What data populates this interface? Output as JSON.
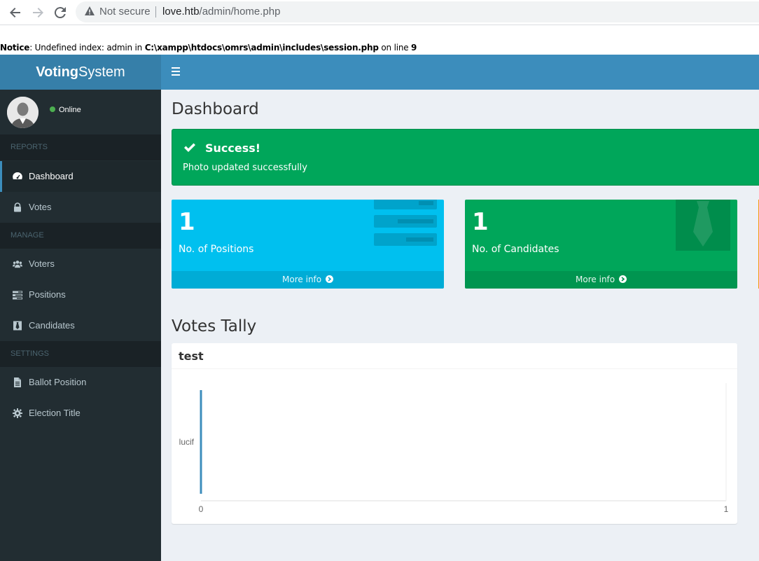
{
  "browser": {
    "security_label": "Not secure",
    "url_host": "love.htb",
    "url_path": "/admin/home.php"
  },
  "notice": {
    "label": "Notice",
    "text_before": ": Undefined index: admin in ",
    "path": "C:\\xampp\\htdocs\\omrs\\admin\\includes\\session.php",
    "text_after": " on line ",
    "line": "9"
  },
  "header": {
    "logo_bold": "Voting",
    "logo_rest": "System"
  },
  "sidebar": {
    "user_status": "Online",
    "sections": [
      {
        "header": "REPORTS",
        "items": [
          {
            "label": "Dashboard",
            "icon": "dashboard-icon",
            "active": true
          },
          {
            "label": "Votes",
            "icon": "lock-icon",
            "active": false
          }
        ]
      },
      {
        "header": "MANAGE",
        "items": [
          {
            "label": "Voters",
            "icon": "users-icon",
            "active": false
          },
          {
            "label": "Positions",
            "icon": "tasks-icon",
            "active": false
          },
          {
            "label": "Candidates",
            "icon": "tie-icon",
            "active": false
          }
        ]
      },
      {
        "header": "SETTINGS",
        "items": [
          {
            "label": "Ballot Position",
            "icon": "file-icon",
            "active": false
          },
          {
            "label": "Election Title",
            "icon": "cog-icon",
            "active": false
          }
        ]
      }
    ]
  },
  "main": {
    "page_title": "Dashboard",
    "alert": {
      "title": "Success!",
      "message": "Photo updated successfully",
      "color": "#00a65a"
    },
    "stat_boxes": [
      {
        "value": "1",
        "label": "No. of Positions",
        "footer": "More info",
        "color": "#00c0ef",
        "icon": "tasks-icon"
      },
      {
        "value": "1",
        "label": "No. of Candidates",
        "footer": "More info",
        "color": "#00a65a",
        "icon": "tie-icon"
      }
    ],
    "tally_title": "Votes Tally"
  },
  "chart_data": {
    "type": "bar",
    "orientation": "horizontal",
    "title": "test",
    "categories": [
      "lucif"
    ],
    "values": [
      0
    ],
    "xlim": [
      0,
      1
    ],
    "x_ticks": [
      "0",
      "1"
    ],
    "bar_color": "#3c8dbc"
  }
}
